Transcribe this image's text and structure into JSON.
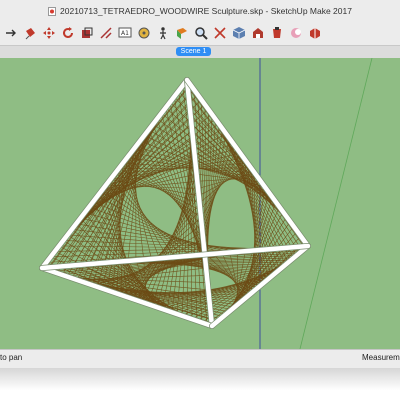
{
  "window": {
    "title": "20210713_TETRAEDRO_WOODWIRE Sculpture.skp - SketchUp Make 2017"
  },
  "toolbar": {
    "icons": [
      "orbit-icon",
      "paint-bucket-icon",
      "move-icon",
      "rotate-icon",
      "scale-icon",
      "offset-icon",
      "tape-measure-icon",
      "text-icon",
      "walk-icon",
      "section-plane-icon",
      "zoom-icon",
      "zoom-extents-icon",
      "component-icon",
      "warehouse-icon",
      "extension-icon",
      "shadow-icon",
      "settings-icon"
    ]
  },
  "scenes": {
    "tabs": [
      {
        "label": "Scene 1"
      }
    ]
  },
  "statusbar": {
    "hint": "to pan",
    "measurements_label": "Measurements"
  },
  "colors": {
    "viewport_bg": "#8fbd84",
    "frame": "#ffffff",
    "wire": "#6b4a14",
    "axis_blue": "#3d4f9e",
    "axis_green": "#5fa85a",
    "scene_tab": "#2f8ef5"
  }
}
